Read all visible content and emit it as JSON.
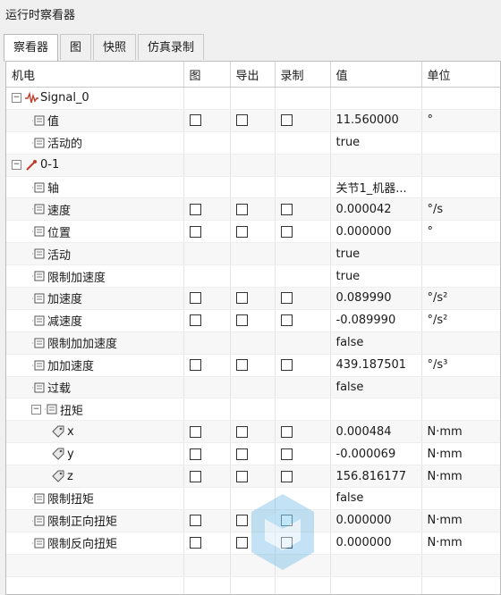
{
  "window": {
    "title": "运行时察看器"
  },
  "tabs": [
    {
      "label": "察看器",
      "active": true
    },
    {
      "label": "图",
      "active": false
    },
    {
      "label": "快照",
      "active": false
    },
    {
      "label": "仿真录制",
      "active": false
    }
  ],
  "columns": [
    "机电",
    "图",
    "导出",
    "录制",
    "值",
    "单位"
  ],
  "rows": [
    {
      "name": "Signal_0",
      "level": 0,
      "icon": "signal-icon",
      "expander": "−",
      "checks": false,
      "value": "",
      "unit": ""
    },
    {
      "name": "值",
      "level": 1,
      "icon": "property-icon",
      "checks": true,
      "value": "11.560000",
      "unit": "°"
    },
    {
      "name": "活动的",
      "level": 1,
      "icon": "property-icon",
      "checks": false,
      "value": "true",
      "unit": ""
    },
    {
      "name": "0-1",
      "level": 0,
      "icon": "joint-icon",
      "expander": "−",
      "checks": false,
      "value": "",
      "unit": ""
    },
    {
      "name": "轴",
      "level": 1,
      "icon": "property-icon",
      "checks": false,
      "value": "关节1_机器...",
      "unit": ""
    },
    {
      "name": "速度",
      "level": 1,
      "icon": "property-icon",
      "checks": true,
      "value": "0.000042",
      "unit": "°/s"
    },
    {
      "name": "位置",
      "level": 1,
      "icon": "property-icon",
      "checks": true,
      "value": "0.000000",
      "unit": "°"
    },
    {
      "name": "活动",
      "level": 1,
      "icon": "property-icon",
      "checks": false,
      "value": "true",
      "unit": ""
    },
    {
      "name": "限制加速度",
      "level": 1,
      "icon": "property-icon",
      "checks": false,
      "value": "true",
      "unit": ""
    },
    {
      "name": "加速度",
      "level": 1,
      "icon": "property-icon",
      "checks": true,
      "value": "0.089990",
      "unit": "°/s²"
    },
    {
      "name": "减速度",
      "level": 1,
      "icon": "property-icon",
      "checks": true,
      "value": "-0.089990",
      "unit": "°/s²"
    },
    {
      "name": "限制加加速度",
      "level": 1,
      "icon": "property-icon",
      "checks": false,
      "value": "false",
      "unit": ""
    },
    {
      "name": "加加速度",
      "level": 1,
      "icon": "property-icon",
      "checks": true,
      "value": "439.187501",
      "unit": "°/s³"
    },
    {
      "name": "过载",
      "level": 1,
      "icon": "property-icon",
      "checks": false,
      "value": "false",
      "unit": ""
    },
    {
      "name": "扭矩",
      "level": 1,
      "icon": "property-icon",
      "expander": "−",
      "checks": false,
      "value": "",
      "unit": ""
    },
    {
      "name": "x",
      "level": 2,
      "icon": "tag-icon",
      "checks": true,
      "value": "0.000484",
      "unit": "N·mm"
    },
    {
      "name": "y",
      "level": 2,
      "icon": "tag-icon",
      "checks": true,
      "value": "-0.000069",
      "unit": "N·mm"
    },
    {
      "name": "z",
      "level": 2,
      "icon": "tag-icon",
      "checks": true,
      "value": "156.816177",
      "unit": "N·mm"
    },
    {
      "name": "限制扭矩",
      "level": 1,
      "icon": "property-icon",
      "checks": false,
      "value": "false",
      "unit": ""
    },
    {
      "name": "限制正向扭矩",
      "level": 1,
      "icon": "property-icon",
      "checks": true,
      "value": "0.000000",
      "unit": "N·mm"
    },
    {
      "name": "限制反向扭矩",
      "level": 1,
      "icon": "property-icon",
      "checks": true,
      "value": "0.000000",
      "unit": "N·mm"
    },
    {
      "name": "",
      "level": 0,
      "checks": false,
      "value": "",
      "unit": ""
    },
    {
      "name": "",
      "level": 0,
      "checks": false,
      "value": "",
      "unit": ""
    },
    {
      "name": "",
      "level": 0,
      "checks": false,
      "value": "",
      "unit": ""
    }
  ],
  "colors": {
    "signal": "#c0392b",
    "joint": "#c0392b",
    "watermark": "#4aa8e0"
  }
}
